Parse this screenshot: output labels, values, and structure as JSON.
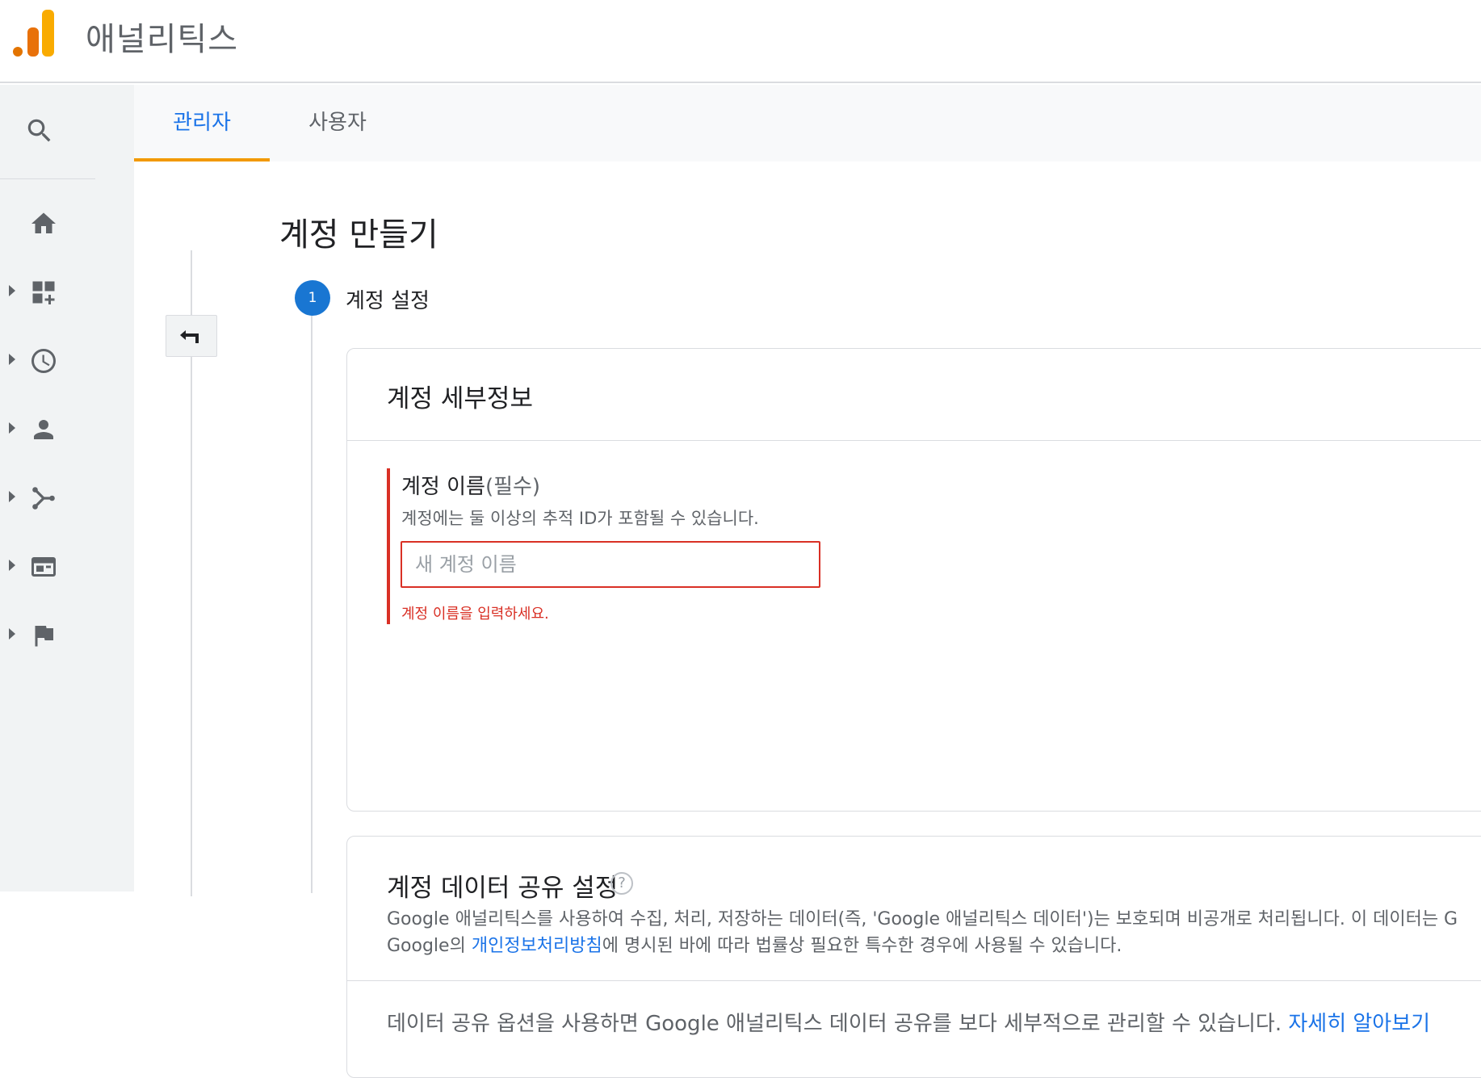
{
  "app": {
    "title": "애널리틱스"
  },
  "tabs": [
    {
      "label": "관리자",
      "active": true
    },
    {
      "label": "사용자",
      "active": false
    }
  ],
  "nav": {
    "icons": [
      "search-icon",
      "home-icon",
      "dashboard-add-icon",
      "clock-icon",
      "person-icon",
      "branch-icon",
      "window-icon",
      "flag-icon"
    ]
  },
  "page": {
    "title": "계정 만들기"
  },
  "step": {
    "number": "1",
    "label": "계정 설정"
  },
  "account_details": {
    "title": "계정 세부정보",
    "field_label": "계정 이름",
    "field_required": "(필수)",
    "field_help": "계정에는 둘 이상의 추적 ID가 포함될 수 있습니다.",
    "input_placeholder": "새 계정 이름",
    "input_value": "",
    "error": "계정 이름을 입력하세요."
  },
  "data_sharing": {
    "title": "계정 데이터 공유 설정",
    "help_glyph": "?",
    "desc1": "Google 애널리틱스를 사용하여 수집, 처리, 저장하는 데이터(즉, 'Google 애널리틱스 데이터')는 보호되며 비공개로 처리됩니다. 이 데이터는 G",
    "desc2_prefix": "Google의 ",
    "desc2_link": "개인정보처리방침",
    "desc2_suffix": "에 명시된 바에 따라 법률상 필요한 특수한 경우에 사용될 수 있습니다.",
    "share_text": "데이터 공유 옵션을 사용하면 Google 애널리틱스 데이터 공유를 보다 세부적으로 관리할 수 있습니다. ",
    "share_link": "자세히 알아보기"
  },
  "colors": {
    "accent": "#1a73e8",
    "tab_underline": "#f29900",
    "error": "#d93025",
    "step_circle": "#1976d2"
  }
}
